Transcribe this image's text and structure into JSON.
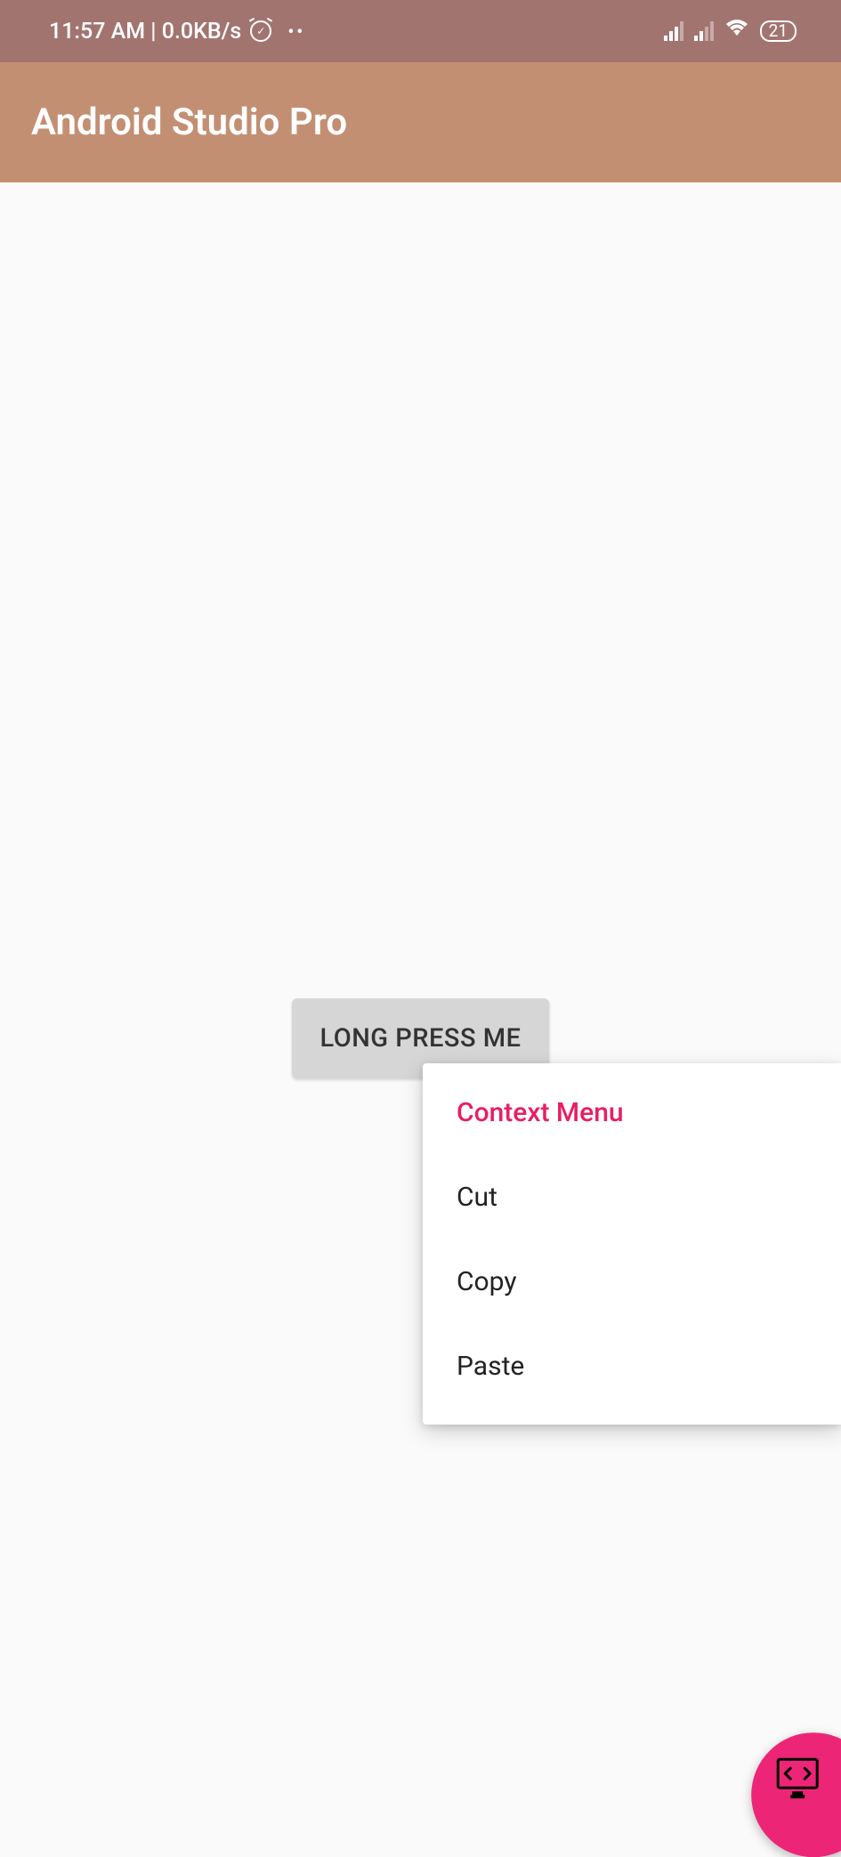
{
  "status_bar": {
    "time": "11:57 AM",
    "network_speed": "0.0KB/s",
    "battery": "21"
  },
  "app_bar": {
    "title": "Android Studio Pro"
  },
  "button": {
    "label": "LONG PRESS ME"
  },
  "context_menu": {
    "title": "Context Menu",
    "items": [
      "Cut",
      "Copy",
      "Paste"
    ]
  },
  "colors": {
    "accent": "#e91e63",
    "fab": "#ed2576",
    "app_bar": "#c38f73",
    "status_bar": "#a27470"
  }
}
